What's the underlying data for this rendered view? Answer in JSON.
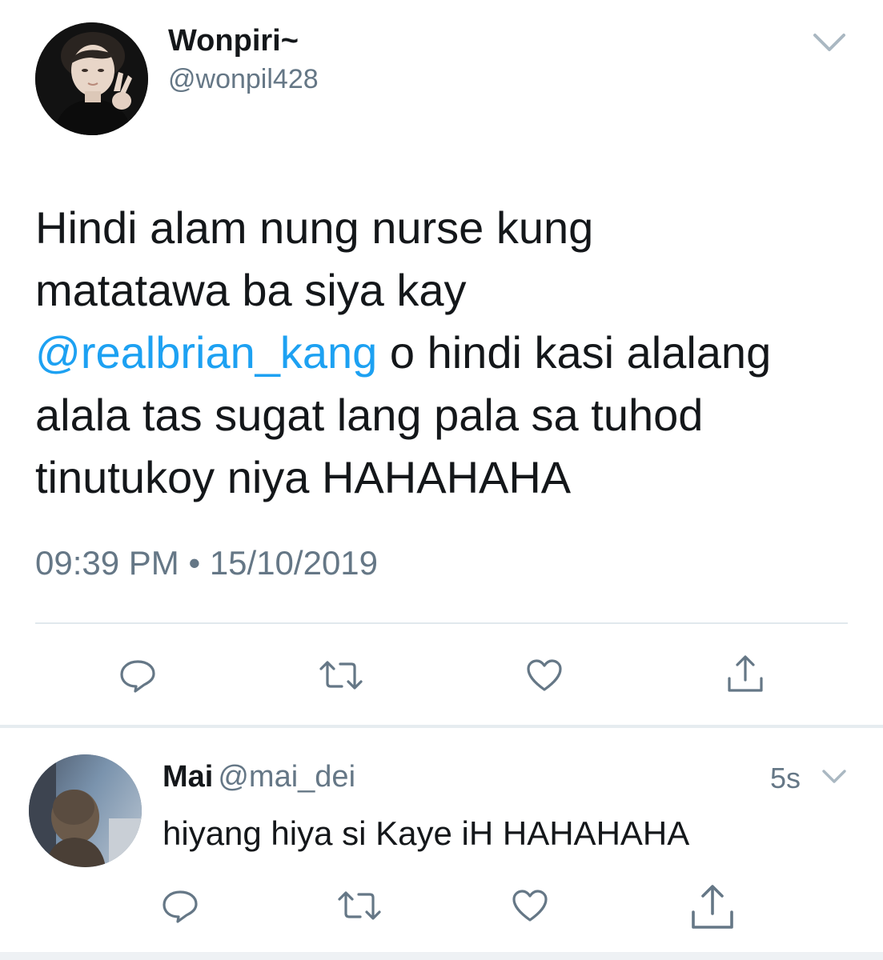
{
  "main_tweet": {
    "display_name": "Wonpiri~",
    "handle": "@wonpil428",
    "text_lines": [
      {
        "plain": "Hindi alam nung nurse kung"
      },
      {
        "plain": "matatawa ba siya kay"
      },
      {
        "mention": "@realbrian_kang",
        "plain": " o hindi kasi alalang"
      },
      {
        "plain": "alala tas sugat lang pala sa tuhod"
      },
      {
        "plain": "tinutukoy niya HAHAHAHA"
      }
    ],
    "timestamp": "09:39 PM • 15/10/2019",
    "actions": [
      "reply-icon",
      "retweet-icon",
      "like-icon",
      "share-icon"
    ]
  },
  "reply_tweet": {
    "display_name": "Mai",
    "handle": "@mai_dei",
    "time": "5s",
    "text": "hiyang hiya si Kaye iH HAHAHAHA",
    "actions": [
      "reply-icon",
      "retweet-icon",
      "like-icon",
      "share-icon"
    ]
  },
  "colors": {
    "text": "#14171a",
    "secondary": "#657786",
    "link": "#1da1f2",
    "divider": "#e1e8ed",
    "icon": "#657786"
  }
}
